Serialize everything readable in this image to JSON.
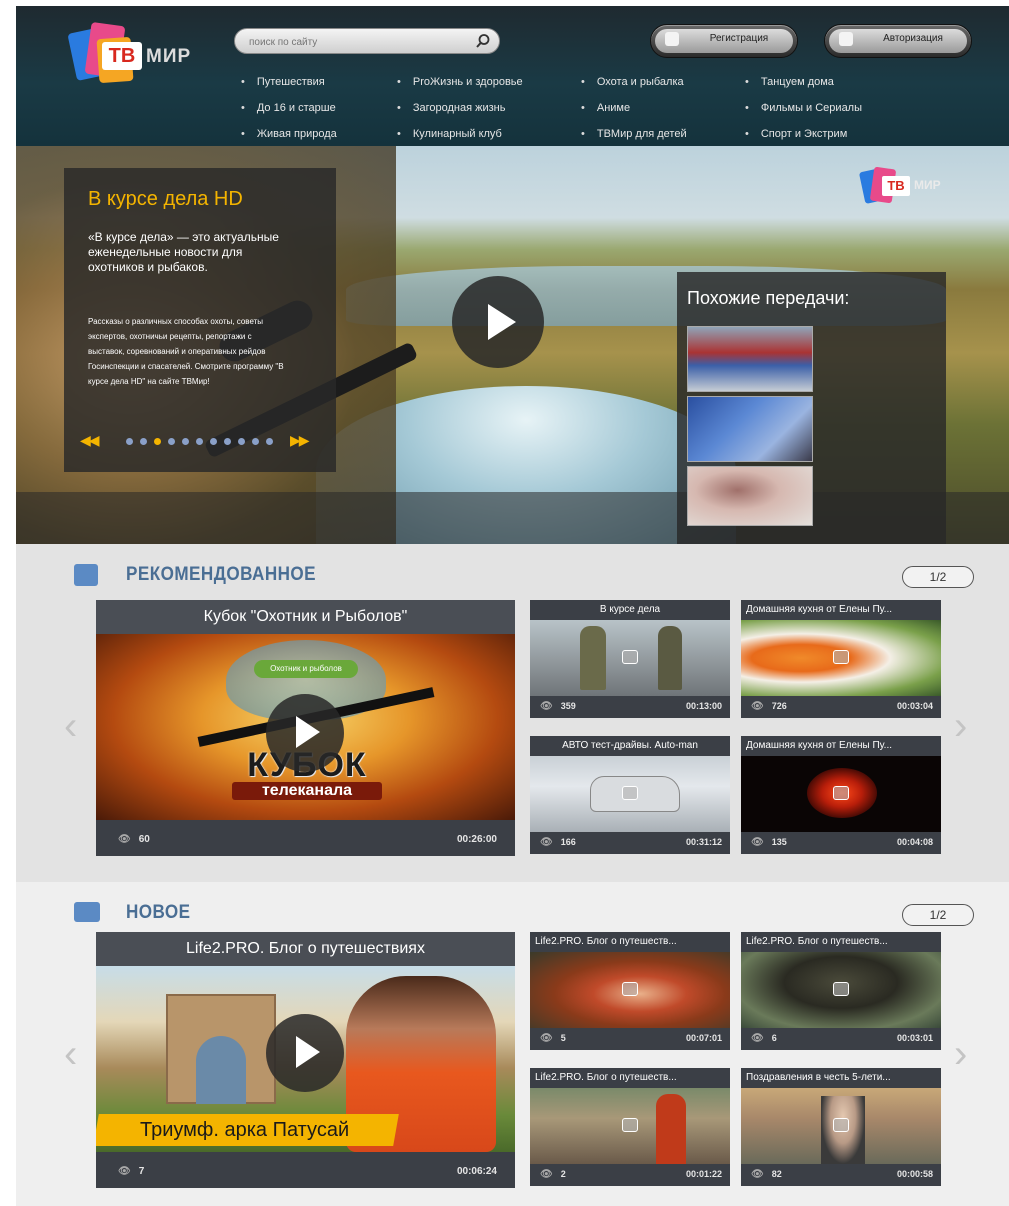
{
  "header": {
    "logo": {
      "tv": "ТВ",
      "mir": "МИР"
    },
    "search": {
      "placeholder": "поиск по сайту",
      "icon": "search-icon"
    },
    "register_label": "Регистрация",
    "login_label": "Авторизация",
    "nav": [
      "Путешествия",
      "ProЖизнь и здоровье",
      "Охота и рыбалка",
      "Танцуем дома",
      "До 16 и старше",
      "Загородная жизнь",
      "Аниме",
      "Фильмы и Сериалы",
      "Живая природа",
      "Кулинарный клуб",
      "ТВМир для детей",
      "Спорт и Экстрим"
    ]
  },
  "hero": {
    "title": "В курсе дела HD",
    "lead": "«В курсе дела» — это актуальные еженедельные новости для охотников и рыбаков.",
    "body": "Рассказы о различных способах охоты, советы экспертов, охотничьи рецепты, репортажи с выставок, соревнований и оперативных рейдов Госинспекции и спасателей. Смотрите программу \"В курсе дела HD\" на сайте ТВМир!",
    "dots": 11,
    "active_dot": 2,
    "similar_title": "Похожие передачи:",
    "logo": {
      "tv": "ТВ",
      "mir": "МИР"
    }
  },
  "recommended": {
    "title": "РЕКОМЕНДОВАННОЕ",
    "pager": "1/2",
    "big": {
      "title": "Кубок \"Охотник и Рыболов\"",
      "views": "60",
      "duration": "00:26:00",
      "overlay_line1": "КУБОК",
      "overlay_line2": "телеканала",
      "overlay_badge": "Охотник и рыболов"
    },
    "items": [
      {
        "title": "В курсе дела",
        "views": "359",
        "duration": "00:13:00"
      },
      {
        "title": "Домашняя кухня от Елены Пу...",
        "views": "726",
        "duration": "00:03:04"
      },
      {
        "title": "АВТО тест-драйвы. Auto-man",
        "views": "166",
        "duration": "00:31:12"
      },
      {
        "title": "Домашняя кухня от Елены Пу...",
        "views": "135",
        "duration": "00:04:08"
      }
    ]
  },
  "new": {
    "title": "НОВОЕ",
    "pager": "1/2",
    "big": {
      "title": "Life2.PRO. Блог о путешествиях",
      "views": "7",
      "duration": "00:06:24",
      "banner": "Триумф. арка Патусай"
    },
    "items": [
      {
        "title": "Life2.PRO. Блог о путешеств...",
        "views": "5",
        "duration": "00:07:01"
      },
      {
        "title": "Life2.PRO. Блог о путешеств...",
        "views": "6",
        "duration": "00:03:01"
      },
      {
        "title": "Life2.PRO. Блог о путешеств...",
        "views": "2",
        "duration": "00:01:22"
      },
      {
        "title": "Поздравления в честь 5-лети...",
        "views": "82",
        "duration": "00:00:58"
      }
    ]
  },
  "colors": {
    "accent": "#f4b400",
    "section_title": "#4a6e94",
    "card_bg": "#3b3f46"
  }
}
